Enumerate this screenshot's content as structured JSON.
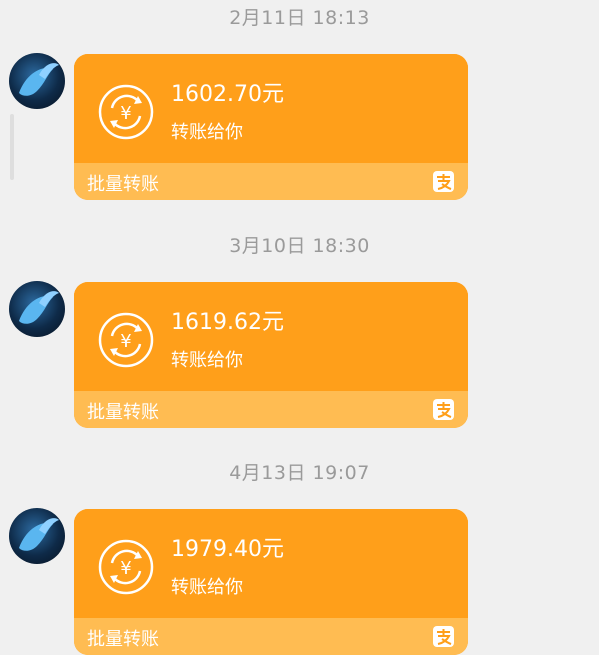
{
  "messages": [
    {
      "time": "2月11日 18:13",
      "amount": "1602.70元",
      "description": "转账给你",
      "footer_label": "批量转账",
      "icon": "alipay-icon"
    },
    {
      "time": "3月10日 18:30",
      "amount": "1619.62元",
      "description": "转账给你",
      "footer_label": "批量转账",
      "icon": "alipay-icon"
    },
    {
      "time": "4月13日 19:07",
      "amount": "1979.40元",
      "description": "转账给你",
      "footer_label": "批量转账",
      "icon": "alipay-icon"
    }
  ],
  "colors": {
    "card": "#ff9f1a",
    "card_footer": "#ffbc52",
    "background": "#f0f0f0",
    "timestamp": "#9a9a9a"
  }
}
